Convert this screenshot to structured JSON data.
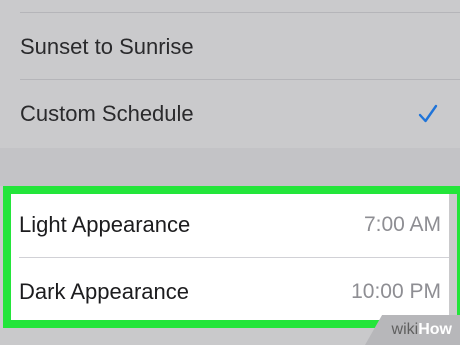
{
  "schedule_options": [
    {
      "label": "Sunset to Sunrise",
      "selected": false
    },
    {
      "label": "Custom Schedule",
      "selected": true
    }
  ],
  "custom_schedule": [
    {
      "label": "Light Appearance",
      "time": "7:00 AM"
    },
    {
      "label": "Dark Appearance",
      "time": "10:00 PM"
    }
  ],
  "watermark": {
    "wiki": "wiki",
    "how": "How"
  },
  "colors": {
    "accent": "#1f74d9",
    "highlight": "#23e53a",
    "secondary_text": "#8e8e93"
  },
  "icons": {
    "selected": "checkmark-icon"
  }
}
